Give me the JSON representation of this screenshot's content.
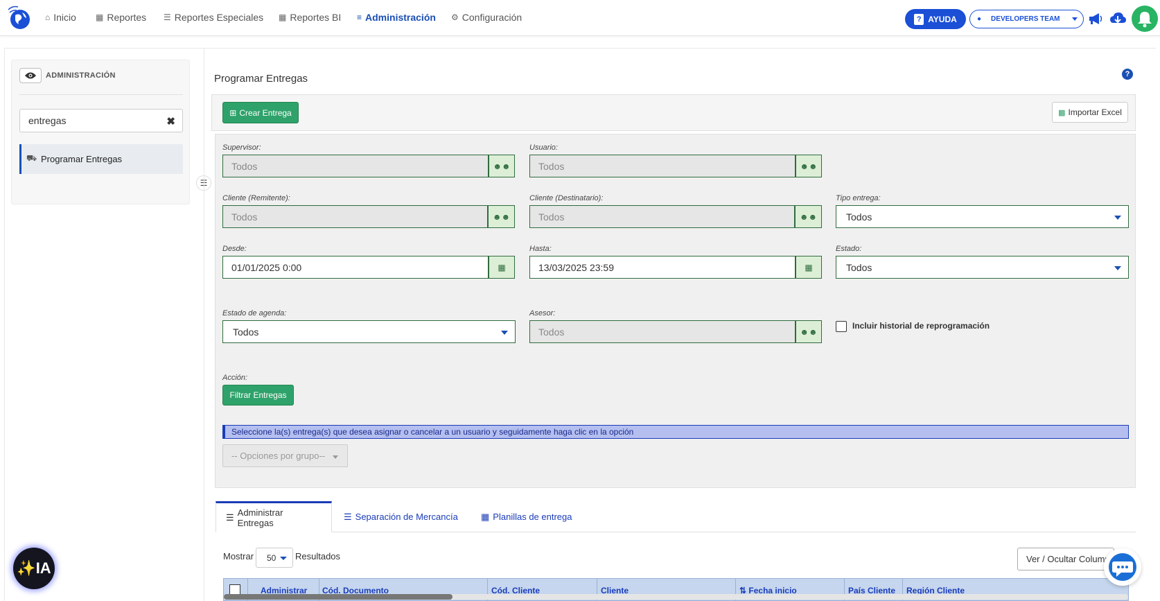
{
  "nav": {
    "items": [
      {
        "label": "Inicio",
        "icon": "home-icon"
      },
      {
        "label": "Reportes",
        "icon": "grid-icon"
      },
      {
        "label": "Reportes Especiales",
        "icon": "list-icon"
      },
      {
        "label": "Reportes BI",
        "icon": "grid-icon"
      },
      {
        "label": "Administración",
        "icon": "sliders-icon",
        "active": true
      },
      {
        "label": "Configuración",
        "icon": "gear-icon"
      }
    ],
    "help_label": "AYUDA",
    "team_label": "DEVELOPERS TEAM"
  },
  "sidebar": {
    "title": "ADMINISTRACIÓN",
    "search_value": "entregas",
    "items": [
      {
        "label": "Programar Entregas",
        "icon": "truck-icon"
      }
    ]
  },
  "main": {
    "title": "Programar Entregas",
    "create_label": "Crear Entrega",
    "import_label": "Importar Excel",
    "filters": {
      "supervisor": {
        "label": "Supervisor:",
        "value": "Todos"
      },
      "usuario": {
        "label": "Usuario:",
        "value": "Todos"
      },
      "cliente_remitente": {
        "label": "Cliente (Remitente):",
        "value": "Todos"
      },
      "cliente_destinatario": {
        "label": "Cliente (Destinatario):",
        "value": "Todos"
      },
      "tipo_entrega": {
        "label": "Tipo entrega:",
        "value": "Todos"
      },
      "desde": {
        "label": "Desde:",
        "value": "01/01/2025 0:00"
      },
      "hasta": {
        "label": "Hasta:",
        "value": "13/03/2025 23:59"
      },
      "estado": {
        "label": "Estado:",
        "value": "Todos"
      },
      "estado_agenda": {
        "label": "Estado de agenda:",
        "value": "Todos"
      },
      "asesor": {
        "label": "Asesor:",
        "value": "Todos"
      },
      "historial_label": "Incluir historial de reprogramación",
      "accion_label": "Acción:",
      "filter_button": "Filtrar Entregas"
    },
    "info_text": "Seleccione la(s) entrega(s) que desea asignar o cancelar a un usuario y seguidamente haga clic en la opción",
    "group_options_placeholder": "-- Opciones por grupo--",
    "tabs": [
      {
        "label": "Administrar Entregas",
        "active": true
      },
      {
        "label": "Separación de Mercancía"
      },
      {
        "label": "Planillas de entrega"
      }
    ],
    "table": {
      "show_label": "Mostrar",
      "page_size": "50",
      "results_label": "Resultados",
      "columns_button": "Ver / Ocultar Columnas",
      "headers": [
        "Administrar",
        "Cód. Documento",
        "Cód. Cliente",
        "Cliente",
        "Fecha inicio",
        "País Cliente",
        "Región Cliente"
      ]
    }
  },
  "ia_label": "✨IA",
  "colors": {
    "brand_blue": "#1a4fd6",
    "green": "#2ea26a",
    "info_bg": "#b4bff0"
  }
}
